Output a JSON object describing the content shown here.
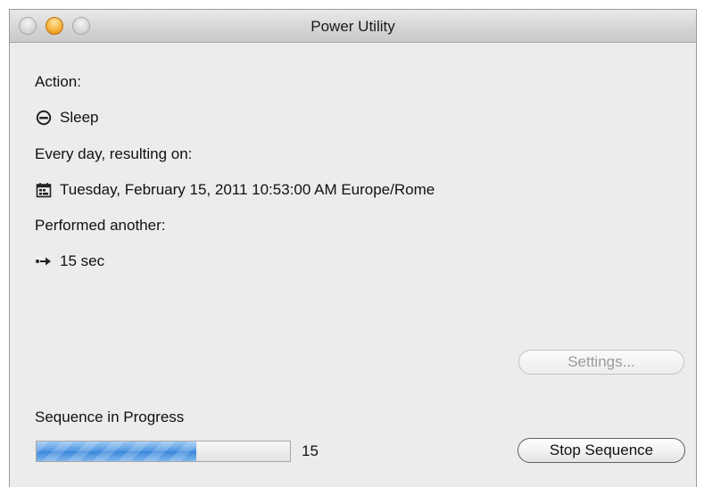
{
  "window": {
    "title": "Power Utility"
  },
  "details": {
    "action_label": "Action:",
    "action_value": "Sleep",
    "schedule_label": "Every day, resulting on:",
    "schedule_value": "Tuesday, February 15, 2011 10:53:00 AM Europe/Rome",
    "performed_label": "Performed another:",
    "performed_value": "15 sec"
  },
  "buttons": {
    "settings_label": "Settings...",
    "stop_label": "Stop Sequence"
  },
  "progress": {
    "label": "Sequence in Progress",
    "value": "15",
    "fraction": 0.63
  },
  "icons": {
    "action": "sleep-icon",
    "schedule": "calendar-icon",
    "performed": "arrow-right-icon"
  },
  "colors": {
    "progress_fill": "#4d95e3"
  }
}
